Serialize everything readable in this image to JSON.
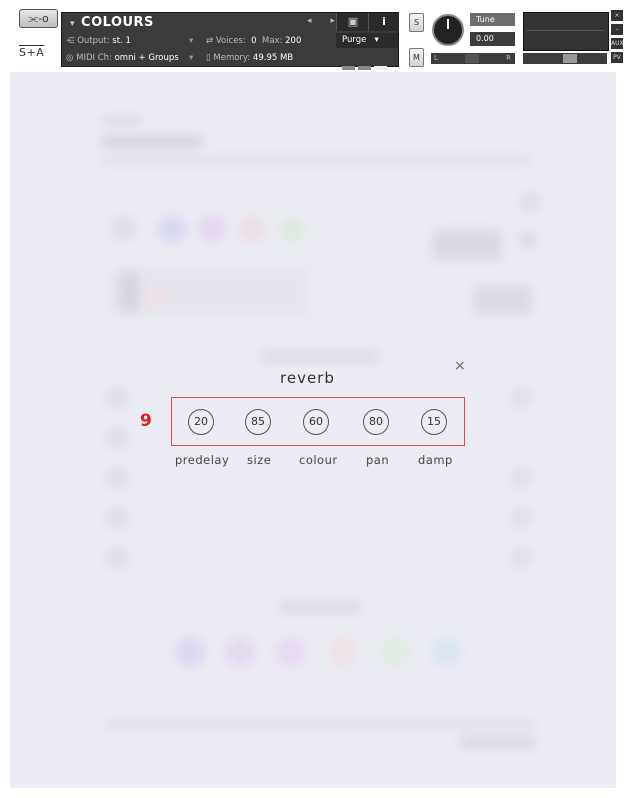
{
  "host": {
    "sa_label": "S+A",
    "instrument_name": "COLOURS",
    "output_label": "Output:",
    "output_value": "st. 1",
    "voices_label": "Voices:",
    "voices_value": "0",
    "max_label": "Max:",
    "max_value": "200",
    "purge_label": "Purge",
    "midi_label": "MIDI Ch:",
    "midi_value": "omni + Groups",
    "memory_label": "Memory:",
    "memory_value": "49.95 MB",
    "solo_label": "S",
    "mute_label": "M",
    "tune_label": "Tune",
    "tune_value": "0.00",
    "pan_left": "L",
    "pan_right": "R",
    "close_glyph": "×",
    "minimize_glyph": "–",
    "aux_label": "AUX",
    "pv_label": "PV"
  },
  "reverb": {
    "title": "reverb",
    "close_glyph": "×",
    "marker": "9",
    "knobs": [
      {
        "label": "predelay",
        "value": "20"
      },
      {
        "label": "size",
        "value": "85"
      },
      {
        "label": "colour",
        "value": "60"
      },
      {
        "label": "pan",
        "value": "80"
      },
      {
        "label": "damp",
        "value": "15"
      }
    ]
  },
  "colors": {
    "panel_bg": "#ececf4",
    "highlight": "#e34b4b",
    "marker": "#e0201c"
  }
}
